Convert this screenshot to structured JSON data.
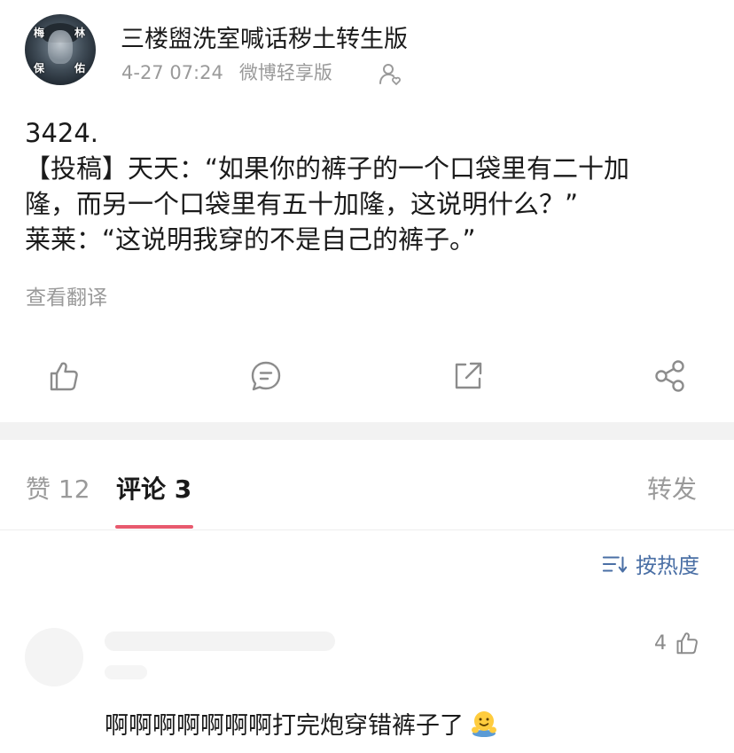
{
  "post": {
    "author": "三楼盥洗室喊话秽土转生版",
    "avatar_chars": [
      "梅",
      "林",
      "保",
      "佑"
    ],
    "time": "4-27 07:24",
    "source": "微博轻享版",
    "lines": [
      "3424.",
      "【投稿】天天：“如果你的裤子的一个口袋里有二十加",
      "隆，而另一个口袋里有五十加隆，这说明什么？”",
      "莱莱：“这说明我穿的不是自己的裤子。”"
    ],
    "translate_label": "查看翻译"
  },
  "actions": [
    {
      "icon": "like-icon"
    },
    {
      "icon": "comment-icon"
    },
    {
      "icon": "repost-icon"
    },
    {
      "icon": "share-icon"
    }
  ],
  "tabs": {
    "likes": "赞 12",
    "comments": "评论 3",
    "reposts": "转发"
  },
  "sort": {
    "label": "按热度",
    "icon": "sort-icon"
  },
  "comment": {
    "likes": "4",
    "text": "啊啊啊啊啊啊啊打完炮穿错裤子了",
    "emoji": "hug-emoji"
  },
  "colors": {
    "accent_underline": "#e85a6e",
    "link_blue": "#4a6fa5",
    "muted_text": "#9a9a9a"
  }
}
